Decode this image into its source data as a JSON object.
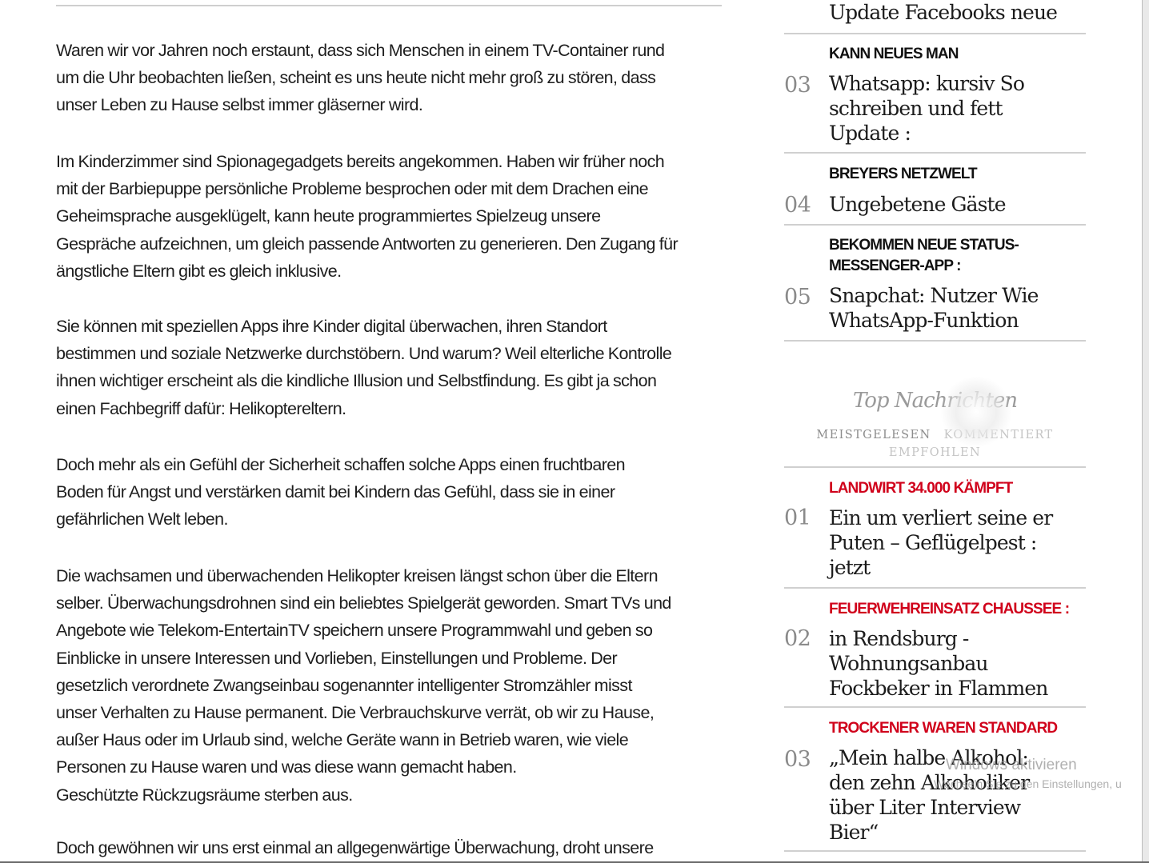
{
  "article": {
    "paragraphs": [
      "Waren wir vor Jahren noch erstaunt, dass sich Menschen in einem TV-Container rund\num die Uhr beobachten ließen, scheint es uns heute nicht mehr groß zu stören, dass\nunser Leben zu Hause selbst immer gläserner wird.",
      "Im Kinderzimmer sind Spionagegadgets bereits angekommen. Haben wir früher noch\nmit der Barbiepuppe persönliche Probleme besprochen oder mit dem Drachen eine\nGeheimsprache ausgeklügelt, kann heute programmiertes Spielzeug unsere\nGespräche aufzeichnen, um gleich passende Antworten zu generieren. Den Zugang für\nängstliche Eltern gibt es gleich inklusive.",
      "Sie können mit speziellen Apps ihre Kinder digital überwachen, ihren Standort\nbestimmen und soziale Netzwerke durchstöbern. Und warum? Weil elterliche Kontrolle\nihnen wichtiger erscheint als die kindliche Illusion und Selbstfindung. Es gibt ja schon\neinen Fachbegriff dafür: Helikoptereltern.",
      "Doch mehr als ein Gefühl der Sicherheit schaffen solche Apps einen fruchtbaren\nBoden für Angst und verstärken damit bei Kindern das Gefühl, dass sie in einer\ngefährlichen Welt leben.",
      "Die wachsamen und überwachenden Helikopter kreisen längst schon über die Eltern\nselber. Überwachungsdrohnen sind ein beliebtes Spielgerät geworden. Smart TVs und\nAngebote wie Telekom-EntertainTV speichern unsere Programmwahl und geben so\nEinblicke in unsere Interessen und Vorlieben, Einstellungen und Probleme. Der\ngesetzlich verordnete Zwangseinbau sogenannter intelligenter Stromzähler misst\nunser Verhalten zu Hause permanent. Die Verbrauchskurve verrät, ob wir zu Hause,\naußer Haus oder im Urlaub sind, welche Geräte wann in Betrieb waren, wie viele\nPersonen zu Hause waren und was diese wann gemacht haben.\nGeschützte Rückzugsräume sterben aus.",
      "Doch gewöhnen wir uns erst einmal an allgegenwärtige Überwachung, droht unsere"
    ]
  },
  "sidebar": {
    "partial_top_headline": "Update Facebooks neue",
    "list_one": [
      {
        "number": "03",
        "kicker": "KANN NEUES MAN",
        "headline": "Whatsapp: kursiv So\nschreiben und fett\nUpdate :"
      },
      {
        "number": "04",
        "kicker": "BREYERS NETZWELT",
        "headline": "Ungebetene Gäste"
      },
      {
        "number": "05",
        "kicker": "BEKOMMEN NEUE STATUS-\nMESSENGER-APP :",
        "headline": "Snapchat: Nutzer Wie\nWhatsApp-Funktion"
      }
    ],
    "top_news": {
      "title": "Top Nachrichten",
      "tabs": [
        "MEISTGELESEN",
        "KOMMENTIERT",
        "EMPFOHLEN"
      ]
    },
    "list_two": [
      {
        "number": "01",
        "kicker": "LANDWIRT 34.000 KÄMPFT",
        "headline": "Ein um verliert seine er\nPuten – Geflügelpest :\njetzt"
      },
      {
        "number": "02",
        "kicker": "FEUERWEHREINSATZ CHAUSSEE :",
        "headline": "in Rendsburg -\nWohnungsanbau\nFockbeker in Flammen"
      },
      {
        "number": "03",
        "kicker": "TROCKENER WAREN STANDARD",
        "headline": "„Mein halbe Alkohol:\nden zehn Alkoholiker\nüber Liter Interview\nBier“"
      }
    ],
    "kicker_red_color": "#d0021b"
  },
  "watermark": {
    "title": "Windows aktivieren",
    "subtitle": "Wechseln Sie zu den Einstellungen, u"
  }
}
